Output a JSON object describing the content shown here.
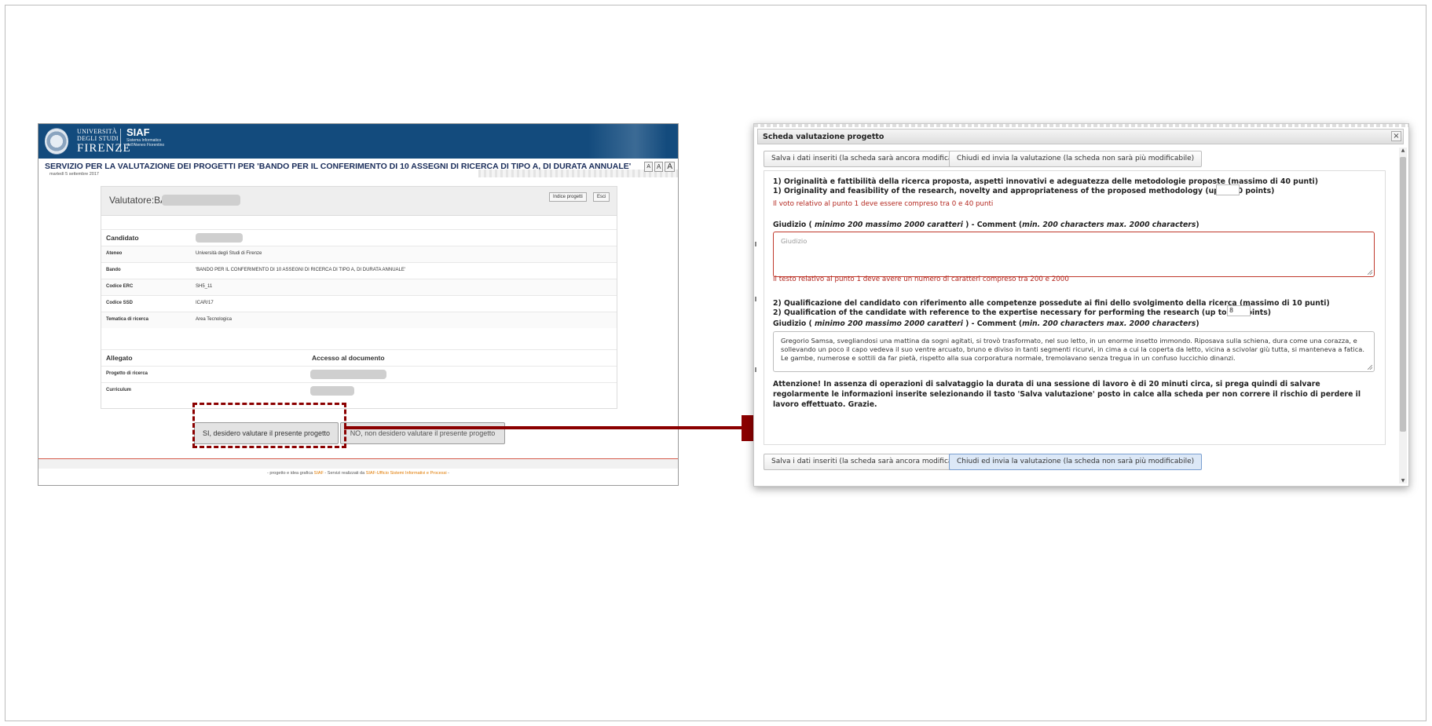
{
  "left": {
    "university": {
      "line1": "UNIVERSITÀ",
      "line2": "DEGLI STUDI",
      "line3": "FIRENZE"
    },
    "siaf": {
      "name": "SIAF",
      "sub1": "Sistema Informatico",
      "sub2": "dell'Ateneo Fiorentino"
    },
    "title": "SERVIZIO PER LA VALUTAZIONE DEI PROGETTI PER 'BANDO PER IL CONFERIMENTO DI 10 ASSEGNI DI RICERCA DI TIPO A, DI DURATA ANNUALE'",
    "date": "martedì 5 settembre 2017",
    "font_sizes": [
      "A",
      "A",
      "A"
    ],
    "valutatore_label": "Valutatore:BA",
    "btn_indice": "Indice progetti",
    "btn_esci": "Esci",
    "rows": [
      {
        "key": "Candidato",
        "value": ""
      },
      {
        "key": "Ateneo",
        "value": "Università degli Studi di Firenze"
      },
      {
        "key": "Bando",
        "value": "'BANDO PER IL CONFERIMENTO DI 10 ASSEGNI DI RICERCA DI TIPO A, DI DURATA ANNUALE'"
      },
      {
        "key": "Codice ERC",
        "value": "SH5_11"
      },
      {
        "key": "Codice SSD",
        "value": "ICAR/17"
      },
      {
        "key": "Tematica di ricerca",
        "value": "Area Tecnologica"
      }
    ],
    "allegato_label": "Allegato",
    "accesso_label": "Accesso al documento",
    "docs": [
      {
        "key": "Progetto di ricerca"
      },
      {
        "key": "Curriculum"
      }
    ],
    "btn_yes": "SI, desidero valutare il presente progetto",
    "btn_no": "NO, non desidero valutare il presente progetto",
    "footer_pre": "- progetto e idea grafica ",
    "footer_link1": "SIAF",
    "footer_mid": " - Servizi realizzati da ",
    "footer_link2": "SIAF-Ufficio Sistemi Informativi e Processi",
    "footer_post": " -"
  },
  "right": {
    "title": "Scheda valutazione progetto",
    "close": "×",
    "btn_save": "Salva i dati inseriti (la scheda sarà ancora modificabile)",
    "btn_send": "Chiudi ed invia la valutazione (la scheda non sarà più modificabile)",
    "q1_it": "1) Originalità e fattibilità della ricerca proposta, aspetti innovativi e adeguatezza delle metodologie proposte (massimo di 40 punti)",
    "q1_en": "1) Originality and feasibility of the research, novelty and appropriateness of the proposed methodology (up to 40 points)",
    "q1_score": "",
    "q1_err": "Il voto relativo al punto 1 deve essere compreso tra 0 e 40 punti",
    "giud_a": "Giudizio ( ",
    "giud_b": "minimo 200 massimo 2000 caratteri",
    "giud_c": " ) - Comment (",
    "giud_d": "min. 200 characters max. 2000 characters",
    "giud_e": ")",
    "giud_placeholder": "Giudizio",
    "giud1_err": "Il testo relativo al punto 1 deve avere un numero di caratteri compreso tra 200 e 2000",
    "q2_it": "2) Qualificazione del candidato con riferimento alle competenze possedute ai fini dello svolgimento della ricerca (massimo di 10 punti)",
    "q2_en": "2) Qualification of the candidate with reference to the expertise necessary for performing the research (up to 10 points)",
    "q2_score": "8",
    "giud2_text": "Gregorio Samsa, svegliandosi una mattina da sogni agitati, si trovò trasformato, nel suo letto, in un enorme insetto immondo. Riposava sulla schiena, dura come una corazza, e sollevando un poco il capo vedeva il suo ventre arcuato, bruno e diviso in tanti segmenti ricurvi, in cima a cui la coperta da letto, vicina a scivolar giù tutta, si manteneva a fatica. Le gambe, numerose e sottili da far pietà, rispetto alla sua corporatura normale, tremolavano senza tregua in un confuso luccichio dinanzi.",
    "warning": "Attenzione! In assenza di operazioni di salvataggio la durata di una sessione di lavoro è di 20 minuti circa, si prega quindi di salvare regolarmente le informazioni inserite selezionando il tasto 'Salva valutazione' posto in calce alla scheda per non correre il rischio di perdere il lavoro effettuato. Grazie."
  },
  "colors": {
    "accent_dark_red": "#8b0000",
    "header_blue": "#134b7d",
    "error_red": "#b3261e"
  }
}
